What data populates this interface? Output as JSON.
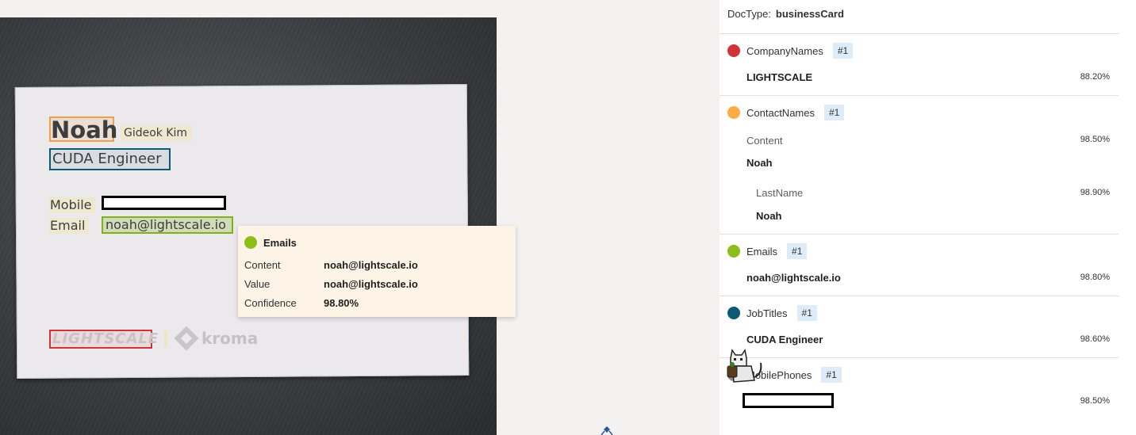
{
  "card": {
    "name": "Noah",
    "korean_name": "Gideok Kim",
    "title": "CUDA Engineer",
    "mobile_label": "Mobile",
    "email_label": "Email",
    "email": "noah@lightscale.io",
    "logo_left": "LIGHTSCALE",
    "logo_right": "kroma"
  },
  "tooltip": {
    "title": "Emails",
    "color": "#8cbd18",
    "rows": [
      {
        "key": "Content",
        "value": "noah@lightscale.io"
      },
      {
        "key": "Value",
        "value": "noah@lightscale.io"
      },
      {
        "key": "Confidence",
        "value": "98.80%"
      }
    ]
  },
  "panel": {
    "doctype_label": "DocType:",
    "doctype_value": "businessCard",
    "fields": [
      {
        "name": "CompanyNames",
        "badge": "#1",
        "color": "#d13438",
        "value": "LIGHTSCALE",
        "confidence": "88.20%"
      },
      {
        "name": "ContactNames",
        "badge": "#1",
        "color": "#ffaa44",
        "content_label": "Content",
        "content_value": "Noah",
        "content_confidence": "98.50%",
        "sub_label": "LastName",
        "sub_value": "Noah",
        "sub_confidence": "98.90%"
      },
      {
        "name": "Emails",
        "badge": "#1",
        "color": "#8cbd18",
        "value": "noah@lightscale.io",
        "confidence": "98.80%"
      },
      {
        "name": "JobTitles",
        "badge": "#1",
        "color": "#0b5a73",
        "value": "CUDA Engineer",
        "confidence": "98.60%"
      },
      {
        "name": "MobilePhones",
        "badge": "#1",
        "value": "",
        "confidence": "98.50%"
      }
    ]
  }
}
